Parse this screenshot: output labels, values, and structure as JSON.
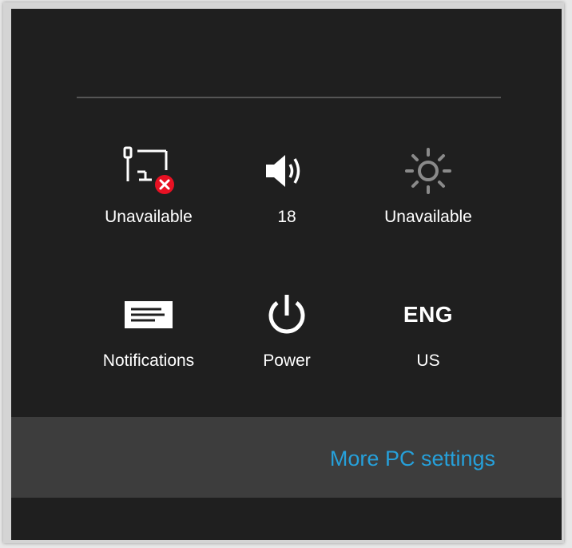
{
  "tiles": {
    "network": {
      "label": "Unavailable",
      "icon": "network-unavailable-icon"
    },
    "volume": {
      "label": "18",
      "icon": "speaker-icon"
    },
    "brightness": {
      "label": "Unavailable",
      "icon": "brightness-icon"
    },
    "notifications": {
      "label": "Notifications",
      "icon": "notifications-icon"
    },
    "power": {
      "label": "Power",
      "icon": "power-icon"
    },
    "language": {
      "code": "ENG",
      "label": "US"
    }
  },
  "footer": {
    "more_label": "More PC settings"
  },
  "colors": {
    "panel_bg": "#1f1f1f",
    "footer_bg": "#3d3d3d",
    "text": "#ffffff",
    "accent_link": "#26a0da",
    "error_badge": "#e81123",
    "disabled_icon": "#8a8a8a"
  }
}
